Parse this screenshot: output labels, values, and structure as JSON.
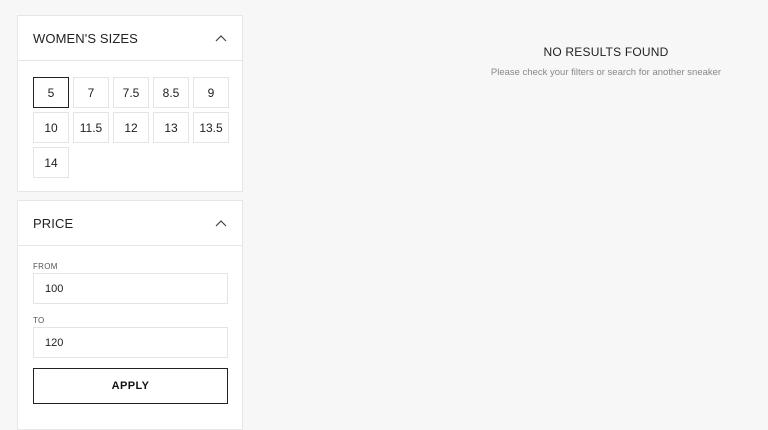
{
  "sizes_panel": {
    "title": "WOMEN'S SIZES",
    "selected": "5",
    "options": [
      "5",
      "7",
      "7.5",
      "8.5",
      "9",
      "10",
      "11.5",
      "12",
      "13",
      "13.5",
      "14"
    ]
  },
  "price_panel": {
    "title": "PRICE",
    "from_label": "FROM",
    "from_value": "100",
    "to_label": "TO",
    "to_value": "120",
    "apply_label": "APPLY"
  },
  "results": {
    "title": "NO RESULTS FOUND",
    "message": "Please check your filters or search for another sneaker"
  },
  "icons": {
    "collapse": "chevron-up-icon"
  }
}
